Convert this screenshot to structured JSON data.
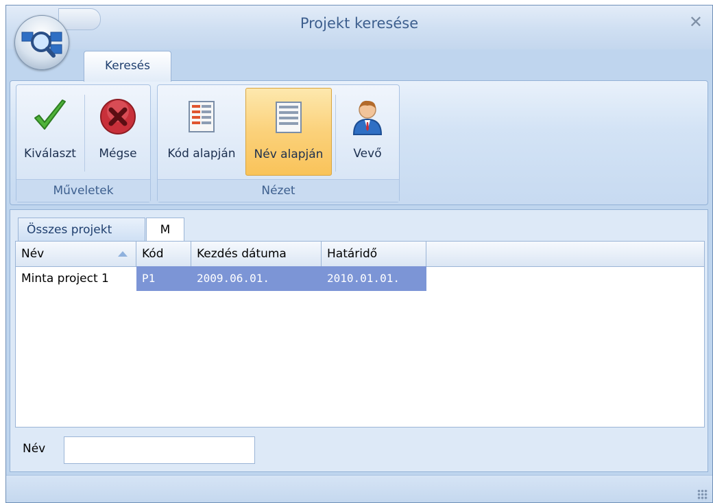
{
  "window": {
    "title": "Projekt keresése"
  },
  "ribbon": {
    "tab_label": "Keresés",
    "groups": [
      {
        "label": "Műveletek",
        "buttons": [
          {
            "label": "Kiválaszt",
            "icon": "checkmark-icon"
          },
          {
            "label": "Mégse",
            "icon": "cancel-icon"
          }
        ]
      },
      {
        "label": "Nézet",
        "buttons": [
          {
            "label": "Kód alapján",
            "icon": "list-code-icon"
          },
          {
            "label": "Név alapján",
            "icon": "list-name-icon",
            "active": true
          },
          {
            "label": "Vevő",
            "icon": "customer-person-icon"
          }
        ]
      }
    ]
  },
  "tabs": [
    {
      "label": "Összes projekt",
      "active": false
    },
    {
      "label": "M",
      "active": true
    }
  ],
  "grid": {
    "columns": [
      "Név",
      "Kód",
      "Kezdés dátuma",
      "Határidő"
    ],
    "sort": {
      "column": "Név",
      "direction": "ascending"
    },
    "rows": [
      {
        "name": "Minta project 1",
        "code": "P1",
        "start": "2009.06.01.",
        "deadline": "2010.01.01."
      }
    ]
  },
  "filter": {
    "label": "Név",
    "value": ""
  },
  "colors": {
    "selection": "#7c95d6",
    "active_button": "#fbd17a",
    "frame": "#bfd5ee"
  }
}
